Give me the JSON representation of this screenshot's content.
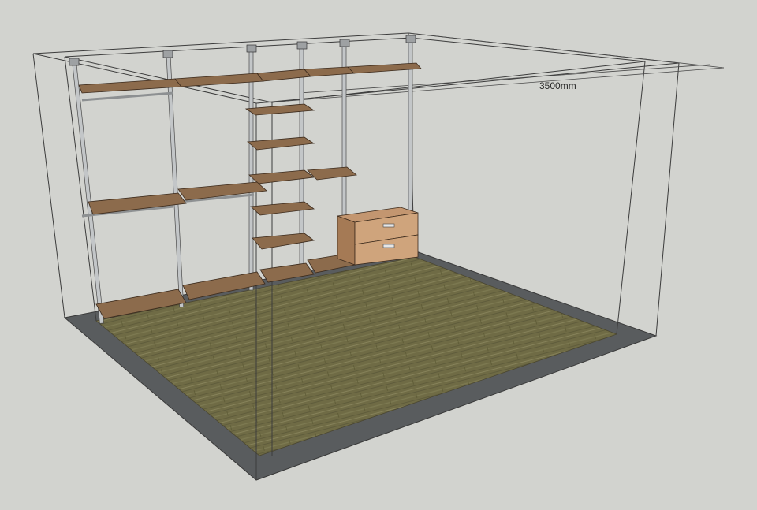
{
  "viewport": {
    "background_color": "#d2d3cf",
    "room_outline_color": "#3c3c3c"
  },
  "dimension": {
    "label": "3500mm"
  },
  "materials": {
    "floor_color": "#6f6b45",
    "floor_border_color": "#595c5e",
    "shelf_top_color": "#8c6b4c",
    "shelf_edge_color": "#5f4632",
    "pole_color": "#c3c6c8",
    "pole_outline_color": "#4a4a4a",
    "drawer_front_color": "#cfa47c",
    "drawer_top_color": "#c39670",
    "drawer_side_color": "#a57a55"
  }
}
